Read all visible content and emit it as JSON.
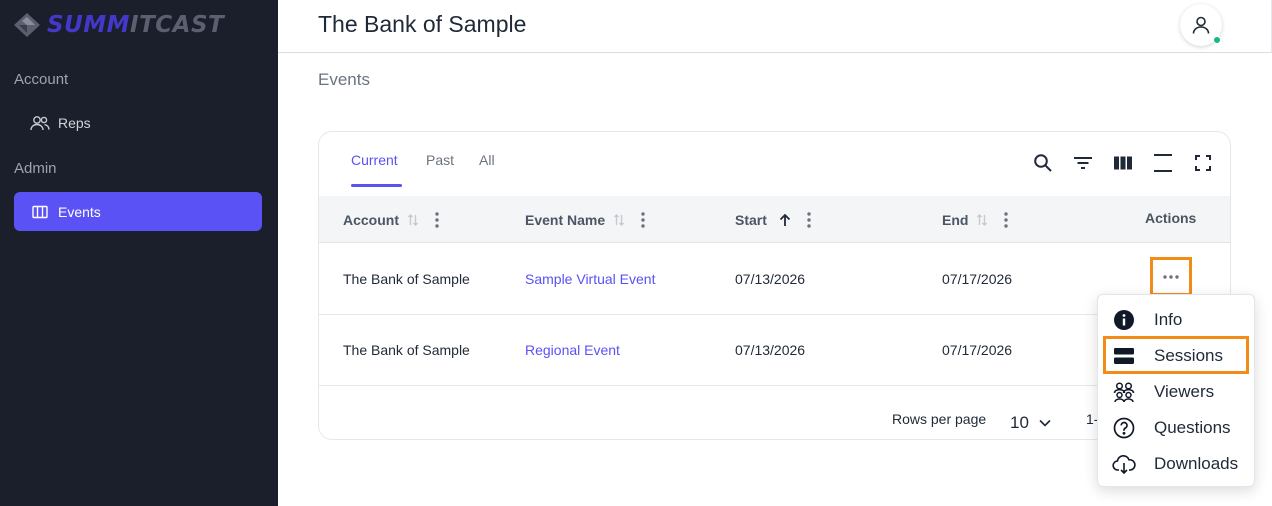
{
  "brand": {
    "logo_part1": "SUMM",
    "logo_part2": "ITCAST"
  },
  "sidebar": {
    "sections": [
      {
        "label": "Account",
        "items": [
          {
            "label": "Reps"
          }
        ]
      },
      {
        "label": "Admin",
        "items": [
          {
            "label": "Events",
            "active": true
          }
        ]
      }
    ]
  },
  "header": {
    "title": "The Bank of Sample"
  },
  "breadcrumb": "Events",
  "tabs": [
    {
      "label": "Current",
      "active": true
    },
    {
      "label": "Past"
    },
    {
      "label": "All"
    }
  ],
  "toolbar_icons": [
    "search-icon",
    "filter-icon",
    "columns-icon",
    "density-icon",
    "fullscreen-icon"
  ],
  "table": {
    "columns": [
      "Account",
      "Event Name",
      "Start",
      "End",
      "Actions"
    ],
    "rows": [
      {
        "account": "The Bank of Sample",
        "event_name": "Sample Virtual Event",
        "start": "07/13/2026",
        "end": "07/17/2026"
      },
      {
        "account": "The Bank of Sample",
        "event_name": "Regional Event",
        "start": "07/13/2026",
        "end": "07/17/2026"
      }
    ]
  },
  "pagination": {
    "rows_per_page_label": "Rows per page",
    "rows_per_page_value": "10",
    "range": "1-"
  },
  "actions_menu": {
    "items": [
      {
        "label": "Info",
        "icon": "info-icon"
      },
      {
        "label": "Sessions",
        "icon": "sessions-icon",
        "highlighted": true
      },
      {
        "label": "Viewers",
        "icon": "viewers-icon"
      },
      {
        "label": "Questions",
        "icon": "question-icon"
      },
      {
        "label": "Downloads",
        "icon": "cloud-download-icon"
      }
    ]
  },
  "colors": {
    "accent": "#5b52f5",
    "sidebar_bg": "#1b1e2b",
    "highlight": "#f28c18",
    "status_online": "#12b886"
  }
}
